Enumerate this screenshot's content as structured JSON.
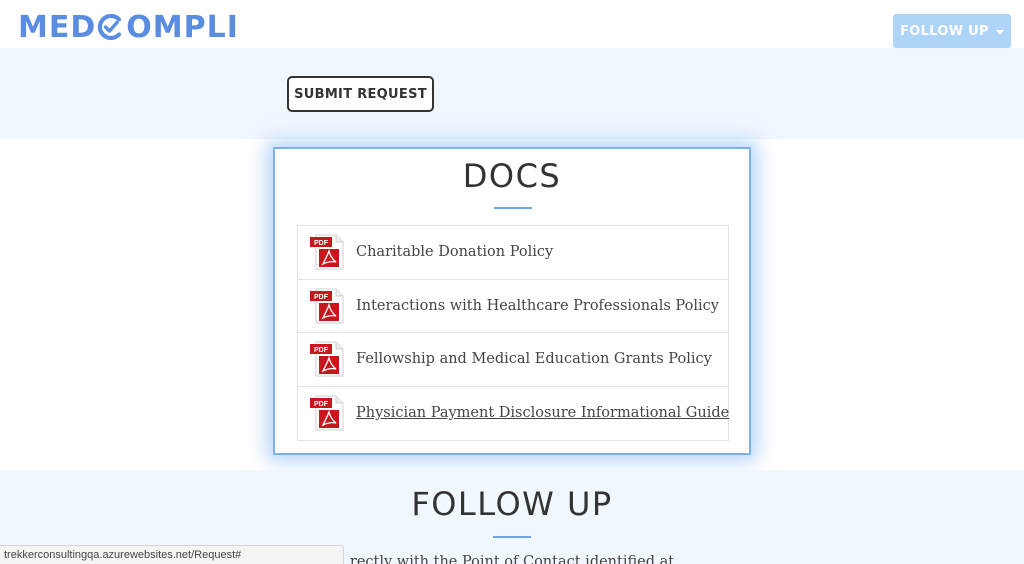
{
  "header": {
    "logo_text_left": "MED",
    "logo_text_right": "OMPLI",
    "logo_mark_icon": "c-checkmark-icon",
    "follow_up_label": "FOLLOW UP"
  },
  "request": {
    "submit_label": "SUBMIT REQUEST"
  },
  "docs": {
    "title": "DOCS",
    "items": [
      {
        "label": "Charitable Donation Policy",
        "icon": "pdf-icon"
      },
      {
        "label": "Interactions with Healthcare Professionals Policy",
        "icon": "pdf-icon"
      },
      {
        "label": "Fellowship and Medical Education Grants Policy",
        "icon": "pdf-icon"
      },
      {
        "label": "Physician Payment Disclosure Informational Guide",
        "icon": "pdf-icon"
      }
    ]
  },
  "follow_up": {
    "heading": "FOLLOW UP",
    "partial_text": "rectly with the Point of Contact identified at"
  },
  "status_bar": {
    "url": "trekkerconsultingqa.azurewebsites.net/Request#"
  },
  "colors": {
    "brand_blue": "#5a8de0",
    "follow_up_button": "#aed4f7",
    "section_band": "#f1f7fe",
    "pdf_red": "#c8161d"
  }
}
